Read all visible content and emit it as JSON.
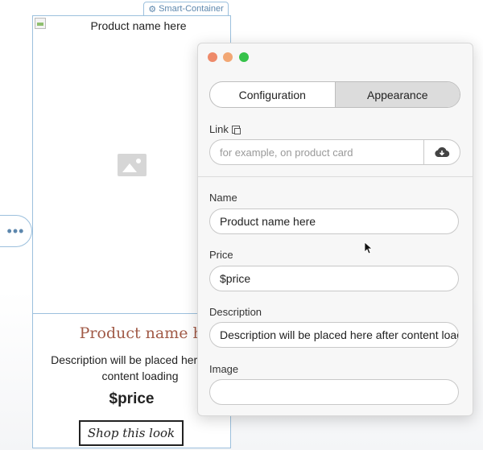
{
  "container": {
    "tag_label": "Smart-Container",
    "image_title": "Product name here",
    "title": "Product name here",
    "description": "Description will be placed here after content loading",
    "price": "$price",
    "shop_button": "Shop this look",
    "handle_label": "•••"
  },
  "panel": {
    "tabs": [
      {
        "label": "Configuration",
        "active": false
      },
      {
        "label": "Appearance",
        "active": true
      }
    ],
    "link": {
      "label": "Link",
      "placeholder": "for example, on product card"
    },
    "fields": {
      "name": {
        "label": "Name",
        "value": "Product name here"
      },
      "price": {
        "label": "Price",
        "value": "$price"
      },
      "description": {
        "label": "Description",
        "value": "Description will be placed here after content loading"
      },
      "image": {
        "label": "Image",
        "value": ""
      }
    }
  },
  "colors": {
    "container_border": "#9cc0dd",
    "title_color": "#a15a47",
    "traffic_close": "#ee8a6a",
    "traffic_min": "#f2a774",
    "traffic_max": "#36c24a"
  },
  "icons": [
    "gear-icon",
    "broken-image-icon",
    "image-placeholder-icon",
    "copy-icon",
    "cloud-download-icon",
    "mouse-cursor-icon"
  ]
}
